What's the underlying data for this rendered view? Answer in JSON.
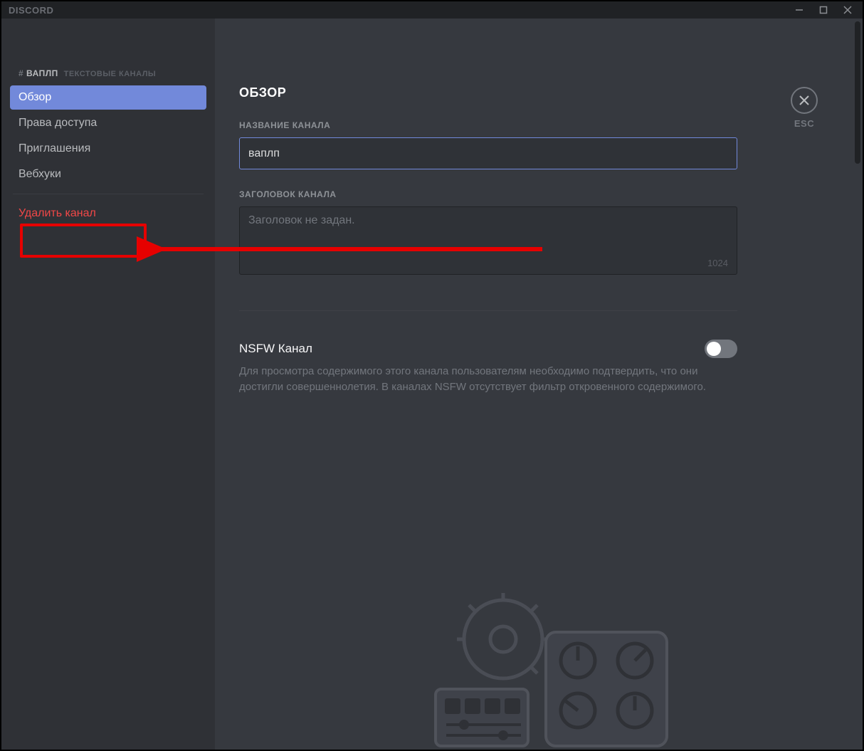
{
  "titlebar": {
    "brand": "DISCORD"
  },
  "sidebar": {
    "hash": "#",
    "channel_name": "ВАПЛП",
    "category": "ТЕКСТОВЫЕ КАНАЛЫ",
    "items": [
      {
        "label": "Обзор",
        "selected": true
      },
      {
        "label": "Права доступа"
      },
      {
        "label": "Приглашения"
      },
      {
        "label": "Вебхуки"
      }
    ],
    "delete_label": "Удалить канал"
  },
  "main": {
    "title": "ОБЗОР",
    "channel_name_label": "НАЗВАНИЕ КАНАЛА",
    "channel_name_value": "ваплп",
    "topic_label": "ЗАГОЛОВОК КАНАЛА",
    "topic_placeholder": "Заголовок не задан.",
    "topic_max": "1024",
    "nsfw_title": "NSFW Канал",
    "nsfw_desc": "Для просмотра содержимого этого канала пользователям необходимо подтвердить, что они достигли совершеннолетия. В каналах NSFW отсутствует фильтр откровенного содержимого."
  },
  "esc": {
    "label": "ESC"
  }
}
